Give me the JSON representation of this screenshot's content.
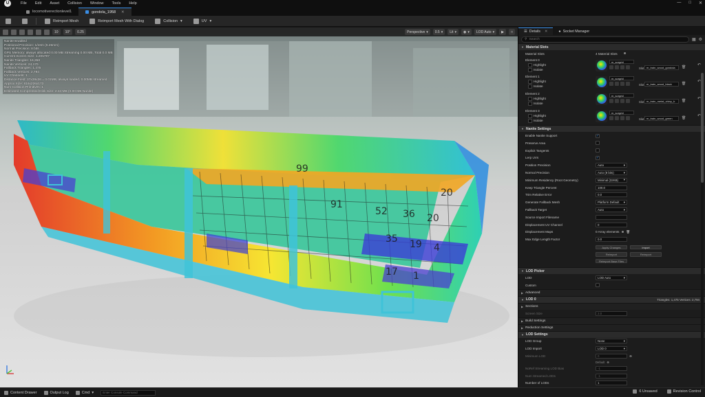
{
  "menu": [
    "File",
    "Edit",
    "Asset",
    "Collision",
    "Window",
    "Tools",
    "Help"
  ],
  "tabs": [
    {
      "label": "locomotiverectionlevel1",
      "active": false
    },
    {
      "label": "gondola_1958",
      "active": true
    }
  ],
  "toolbar": {
    "reimport_label": "Reimport Mesh",
    "reimport_dialog_label": "Reimport Mesh With Dialog",
    "collision_label": "Collision",
    "uv_label": "UV"
  },
  "viewport": {
    "perspective_label": "Perspective",
    "lit_label": "Lit",
    "lod_label": "LOD Auto",
    "speed_label": "0.5",
    "grid_label": "10",
    "rot_label": "10°",
    "scale_label": "0.25",
    "stats": [
      "Nanite Enabled",
      "Positional Precision: 1/16m (6.25mm)",
      "Normal Precision: 8 bits",
      "GPU Memory: always allocated 0.00 MB Streaming 0.00 MB, Total 0.0 MB",
      "Current Screen Size: 1.205797",
      "Nanite Triangles: 16,358",
      "Nanite Vertices: 24,170",
      "Fallback Triangles: 1,475",
      "Fallback Vertices: 2,794",
      "UV Channels: 1",
      "Distance Field: 37x39x36 = 0.01MB, always loaded, 0.00MB streamed",
      "Approx Size: 816x226x173",
      "Num Collision Primitives: 1",
      "Estimated Compressed Disk Size: 2.34 MB (0.00 MB Nanite)"
    ]
  },
  "status": {
    "content_drawer": "Content Drawer",
    "output_log": "Output Log",
    "cmd_label": "Cmd",
    "cmd_placeholder": "Enter Console Command",
    "unsaved": "6 Unsaved",
    "revision": "Revision Control"
  },
  "details": {
    "tab_details": "Details",
    "tab_socket": "Socket Manager",
    "search_placeholder": "Search",
    "material_slots_header": "Material Slots",
    "material_slots_label": "Material Slots",
    "material_slots_value": "4 Material Slots",
    "highlight_label": "Highlight",
    "isolate_label": "Isolate",
    "slot_label": "Slot",
    "elements": [
      {
        "name": "Element 0",
        "material": "m_sorgrid",
        "slot": "m_train_wood_gondola"
      },
      {
        "name": "Element 1",
        "material": "m_sorgrid",
        "slot": "m_train_wood_black"
      },
      {
        "name": "Element 2",
        "material": "m_sorgrid",
        "slot": "m_train_metal_shiny_b"
      },
      {
        "name": "Element 3",
        "material": "m_sorgrid",
        "slot": "m_train_wood_green"
      }
    ],
    "nanite_header": "Nanite Settings",
    "nanite_rows": [
      {
        "label": "Enable Nanite Support",
        "type": "check",
        "checked": true
      },
      {
        "label": "Preserve Area",
        "type": "check",
        "checked": false
      },
      {
        "label": "Explicit Tangents",
        "type": "check",
        "checked": false
      },
      {
        "label": "Lerp UVs",
        "type": "check",
        "checked": true
      },
      {
        "label": "Position Precision",
        "type": "dd",
        "value": "Auto"
      },
      {
        "label": "Normal Precision",
        "type": "dd",
        "value": "Auto (8 bits)"
      },
      {
        "label": "Minimum Residency (Root Geometry)",
        "type": "dd",
        "value": "Minimal (32KB)"
      },
      {
        "label": "Keep Triangle Percent",
        "type": "num",
        "value": "100.0"
      },
      {
        "label": "Trim Relative Error",
        "type": "num",
        "value": "0.0"
      },
      {
        "label": "Generate Fallback Mesh",
        "type": "dd",
        "value": "Platform Default"
      },
      {
        "label": "Fallback Target",
        "type": "dd",
        "value": "Auto"
      },
      {
        "label": "Source Import Filename",
        "type": "num",
        "value": ""
      },
      {
        "label": "Displacement UV Channel",
        "type": "num",
        "value": "0"
      },
      {
        "label": "Displacement Maps",
        "type": "text",
        "value": "0 Array elements"
      },
      {
        "label": "Max Edge Length Factor",
        "type": "num",
        "value": "0.0"
      }
    ],
    "nanite_buttons": [
      "Apply Changes",
      "Import",
      "Reimport",
      "Reimport",
      "Reimport Base Files"
    ],
    "lod_picker_header": "LOD Picker",
    "lod_label": "LOD",
    "lod_value": "LOD Auto",
    "custom_label": "Custom",
    "advanced_label": "Advanced",
    "lod0_label": "LOD 0",
    "lod0_info": "Triangles: 1,475  Vertices: 2,794",
    "sections_label": "Sections",
    "screen_size_label": "Screen Size",
    "screen_size_value": "2.0",
    "build_settings_label": "Build Settings",
    "reduction_settings_label": "Reduction Settings",
    "lod_settings_header": "LOD Settings",
    "lod_group_label": "LOD Group",
    "lod_group_value": "None",
    "lod_import_label": "LOD Import",
    "lod_import_value": "LOD 0",
    "minimum_lod_label": "Minimum LOD",
    "minimum_lod_value": "0",
    "default_label": "Default",
    "no_ref_label": "NoRef Streaming LOD Bias",
    "no_ref_value": "-1",
    "num_streamed_label": "Num Streamed LODs",
    "num_streamed_value": "-1",
    "number_lods_label": "Number of LODs",
    "number_lods_value": "1"
  },
  "colors": {
    "accent": "#3a8ee6",
    "panel": "#1c1c1c",
    "section": "#2b2b2b"
  }
}
